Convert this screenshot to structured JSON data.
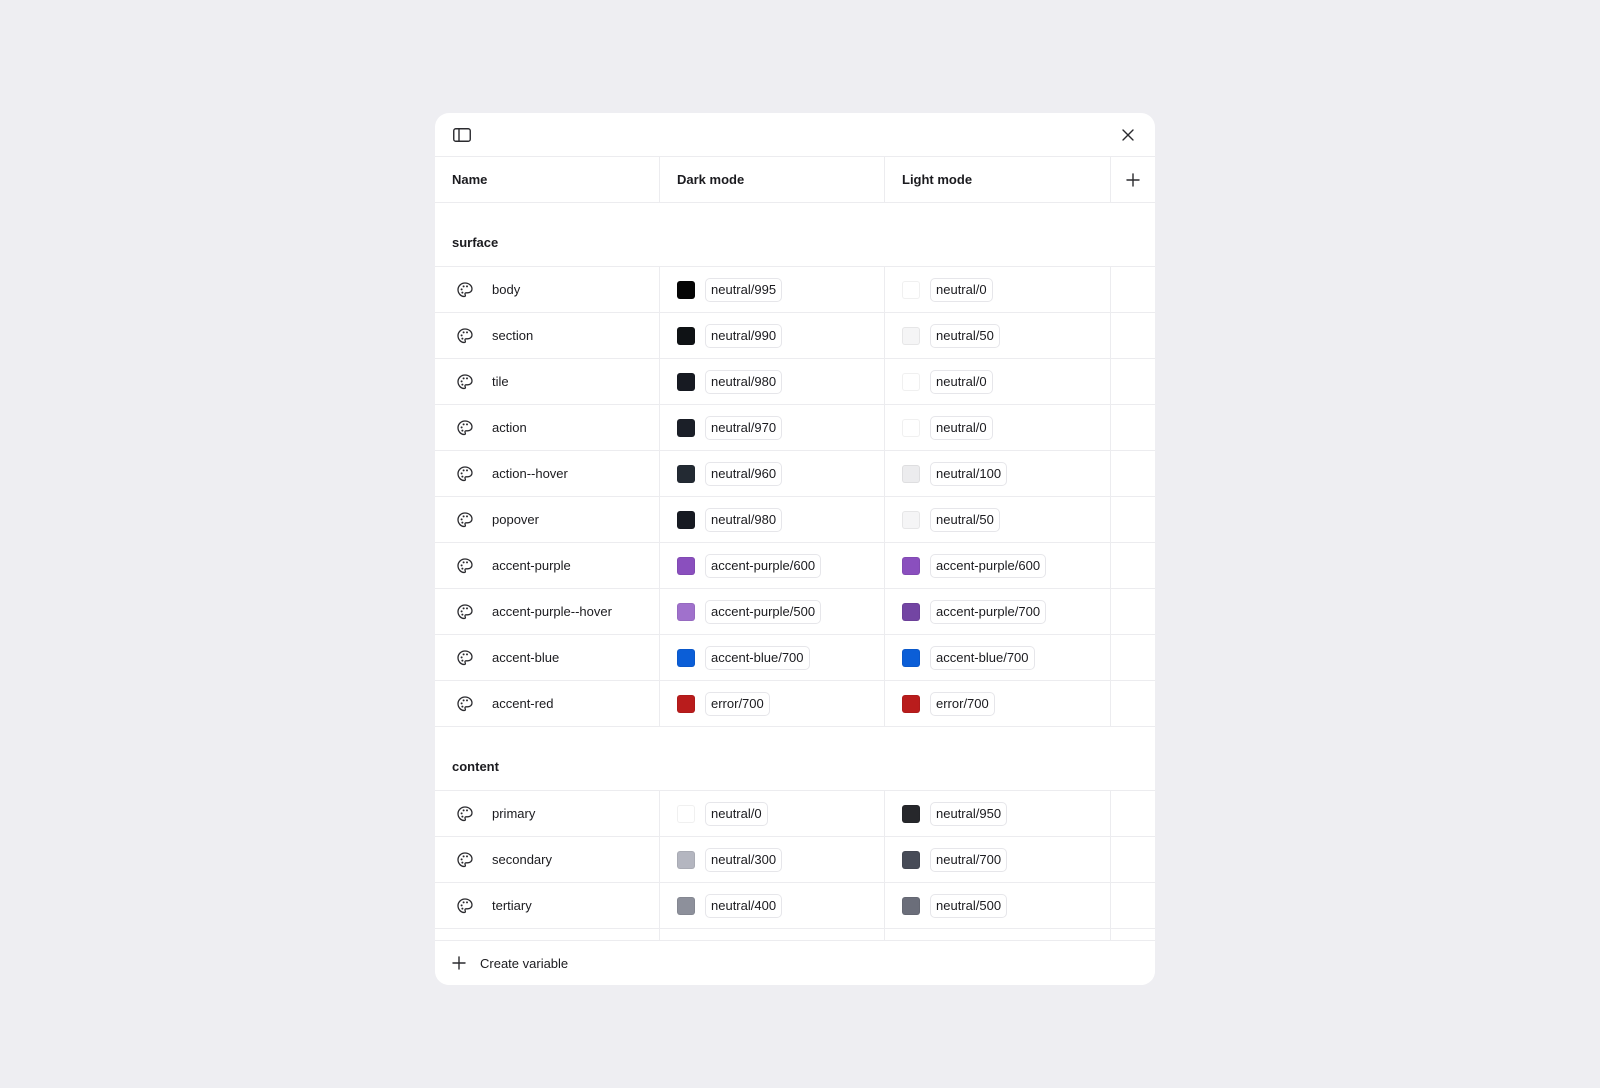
{
  "toolbar": {
    "sidebar_toggle_icon": "sidebar-panel-icon",
    "close_icon": "close-icon"
  },
  "columns": {
    "name": "Name",
    "dark": "Dark mode",
    "light": "Light mode",
    "add_icon": "plus-icon"
  },
  "groups": [
    {
      "title": "surface",
      "rows": [
        {
          "name": "body",
          "dark": {
            "token": "neutral/995",
            "color": "#050505"
          },
          "light": {
            "token": "neutral/0",
            "color": "#ffffff"
          }
        },
        {
          "name": "section",
          "dark": {
            "token": "neutral/990",
            "color": "#0f1215"
          },
          "light": {
            "token": "neutral/50",
            "color": "#f5f5f6"
          }
        },
        {
          "name": "tile",
          "dark": {
            "token": "neutral/980",
            "color": "#171a22"
          },
          "light": {
            "token": "neutral/0",
            "color": "#ffffff"
          }
        },
        {
          "name": "action",
          "dark": {
            "token": "neutral/970",
            "color": "#1b1f28"
          },
          "light": {
            "token": "neutral/0",
            "color": "#ffffff"
          }
        },
        {
          "name": "action--hover",
          "dark": {
            "token": "neutral/960",
            "color": "#232a33"
          },
          "light": {
            "token": "neutral/100",
            "color": "#ececee"
          }
        },
        {
          "name": "popover",
          "dark": {
            "token": "neutral/980",
            "color": "#171a22"
          },
          "light": {
            "token": "neutral/50",
            "color": "#f5f5f6"
          }
        },
        {
          "name": "accent-purple",
          "dark": {
            "token": "accent-purple/600",
            "color": "#8a4fbe"
          },
          "light": {
            "token": "accent-purple/600",
            "color": "#8a4fbe"
          }
        },
        {
          "name": "accent-purple--hover",
          "dark": {
            "token": "accent-purple/500",
            "color": "#a071cc"
          },
          "light": {
            "token": "accent-purple/700",
            "color": "#7345a3"
          }
        },
        {
          "name": "accent-blue",
          "dark": {
            "token": "accent-blue/700",
            "color": "#0b5ed7"
          },
          "light": {
            "token": "accent-blue/700",
            "color": "#0b5ed7"
          }
        },
        {
          "name": "accent-red",
          "dark": {
            "token": "error/700",
            "color": "#b91c1c"
          },
          "light": {
            "token": "error/700",
            "color": "#b91c1c"
          }
        }
      ]
    },
    {
      "title": "content",
      "rows": [
        {
          "name": "primary",
          "dark": {
            "token": "neutral/0",
            "color": "#ffffff"
          },
          "light": {
            "token": "neutral/950",
            "color": "#26272b"
          }
        },
        {
          "name": "secondary",
          "dark": {
            "token": "neutral/300",
            "color": "#b4b6c0"
          },
          "light": {
            "token": "neutral/700",
            "color": "#474b57"
          }
        },
        {
          "name": "tertiary",
          "dark": {
            "token": "neutral/400",
            "color": "#8d909b"
          },
          "light": {
            "token": "neutral/500",
            "color": "#6b6e7a"
          }
        }
      ]
    }
  ],
  "footer": {
    "create_label": "Create variable"
  }
}
